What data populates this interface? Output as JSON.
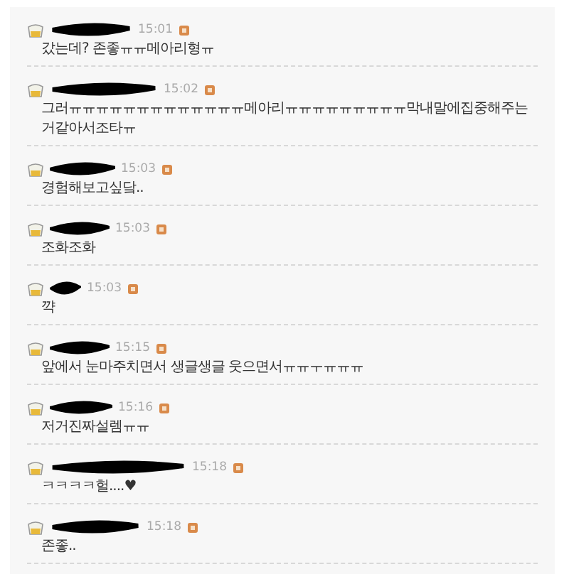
{
  "comments": [
    {
      "time": "15:01",
      "text": "갔는데? 존좋ㅠㅠ메아리형ㅠ"
    },
    {
      "time": "15:02",
      "text": "그러ㅠㅠㅠㅠㅠㅠㅠㅠㅠㅠㅠㅠㅠ메아리ㅠㅠㅠㅠㅠㅠㅠㅠㅠ막내말에집중해주는거같아서조타ㅠ"
    },
    {
      "time": "15:03",
      "text": "경험해보고싶닼.."
    },
    {
      "time": "15:03",
      "text": "조화조화"
    },
    {
      "time": "15:03",
      "text": "꺅"
    },
    {
      "time": "15:15",
      "text": "앞에서 눈마주치면서 생글생글 웃으면서ㅠㅠㅜㅠㅠㅠ"
    },
    {
      "time": "15:16",
      "text": "저거진짜설렘ㅠㅠ"
    },
    {
      "time": "15:18",
      "text": "ㅋㅋㅋㅋ헐....♥"
    },
    {
      "time": "15:18",
      "text": "존좋.."
    }
  ]
}
